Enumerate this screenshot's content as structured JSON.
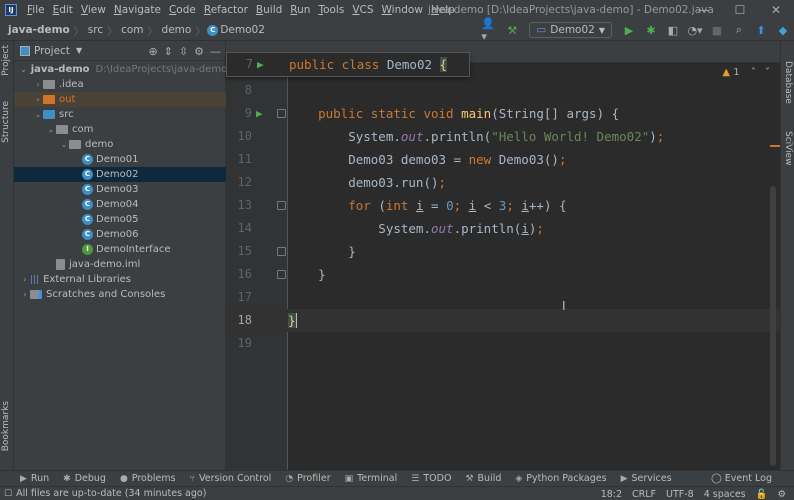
{
  "menubar": {
    "logo": "IJ",
    "items": [
      "File",
      "Edit",
      "View",
      "Navigate",
      "Code",
      "Refactor",
      "Build",
      "Run",
      "Tools",
      "VCS",
      "Window",
      "Help"
    ],
    "window_title": "java-demo [D:\\IdeaProjects\\java-demo] - Demo02.java",
    "minimize": "—",
    "maximize": "☐",
    "close": "✕"
  },
  "navbar": {
    "breadcrumbs": [
      "java-demo",
      "src",
      "com",
      "demo",
      "Demo02"
    ],
    "separator": "〉",
    "run_config": "Demo02",
    "icons": [
      "user-icon",
      "build-hammer-icon",
      "run-icon",
      "debug-icon",
      "coverage-icon",
      "profile-icon",
      "stop-icon",
      "search-icon",
      "update-icon",
      "plugin-icon"
    ]
  },
  "left_strip": {
    "labels": [
      "Project",
      "Structure",
      "Bookmarks"
    ]
  },
  "right_strip": {
    "labels": [
      "Database",
      "SciView"
    ]
  },
  "project_panel": {
    "title": "Project",
    "tree": [
      {
        "label": "java-demo",
        "extra": "D:\\IdeaProjects\\java-demo",
        "type": "module",
        "indent": 0,
        "arrow": "⌄"
      },
      {
        "label": ".idea",
        "type": "folder-grey",
        "indent": 1,
        "arrow": "›"
      },
      {
        "label": "out",
        "type": "folder-orange",
        "indent": 1,
        "arrow": "›"
      },
      {
        "label": "src",
        "type": "folder-blue",
        "indent": 1,
        "arrow": "⌄"
      },
      {
        "label": "com",
        "type": "package",
        "indent": 2,
        "arrow": "⌄"
      },
      {
        "label": "demo",
        "type": "package",
        "indent": 3,
        "arrow": "⌄"
      },
      {
        "label": "Demo01",
        "type": "class",
        "indent": 4
      },
      {
        "label": "Demo02",
        "type": "class",
        "indent": 4,
        "selected": true
      },
      {
        "label": "Demo03",
        "type": "class",
        "indent": 4
      },
      {
        "label": "Demo04",
        "type": "class",
        "indent": 4
      },
      {
        "label": "Demo05",
        "type": "class",
        "indent": 4
      },
      {
        "label": "Demo06",
        "type": "class",
        "indent": 4
      },
      {
        "label": "DemoInterface",
        "type": "interface",
        "indent": 4
      },
      {
        "label": "java-demo.iml",
        "type": "file",
        "indent": 2
      },
      {
        "label": "External Libraries",
        "type": "libraries",
        "indent": 0,
        "arrow": "›"
      },
      {
        "label": "Scratches and Consoles",
        "type": "scratches",
        "indent": 0,
        "arrow": "›"
      }
    ]
  },
  "editor": {
    "file": "Demo02.java",
    "warnings": "1",
    "sticky_line": {
      "number": "7",
      "code": "public class Demo02 {"
    },
    "current_line": 18,
    "lines": [
      {
        "n": "8"
      },
      {
        "n": "9"
      },
      {
        "n": "10"
      },
      {
        "n": "11"
      },
      {
        "n": "12"
      },
      {
        "n": "13"
      },
      {
        "n": "14"
      },
      {
        "n": "15"
      },
      {
        "n": "16"
      },
      {
        "n": "17"
      },
      {
        "n": "18"
      },
      {
        "n": "19"
      }
    ]
  },
  "bottom_tools": [
    {
      "label": "Run",
      "icon": "▶"
    },
    {
      "label": "Debug",
      "icon": "✱"
    },
    {
      "label": "Problems",
      "icon": "●"
    },
    {
      "label": "Version Control",
      "icon": "⑂"
    },
    {
      "label": "Profiler",
      "icon": "◔"
    },
    {
      "label": "Terminal",
      "icon": "▣"
    },
    {
      "label": "TODO",
      "icon": "☰"
    },
    {
      "label": "Build",
      "icon": "⚒"
    },
    {
      "label": "Python Packages",
      "icon": "◈"
    },
    {
      "label": "Services",
      "icon": "▶"
    }
  ],
  "event_log": "Event Log",
  "status": {
    "message": "All files are up-to-date (34 minutes ago)",
    "position": "18:2",
    "line_sep": "CRLF",
    "encoding": "UTF-8",
    "indent": "4 spaces"
  }
}
